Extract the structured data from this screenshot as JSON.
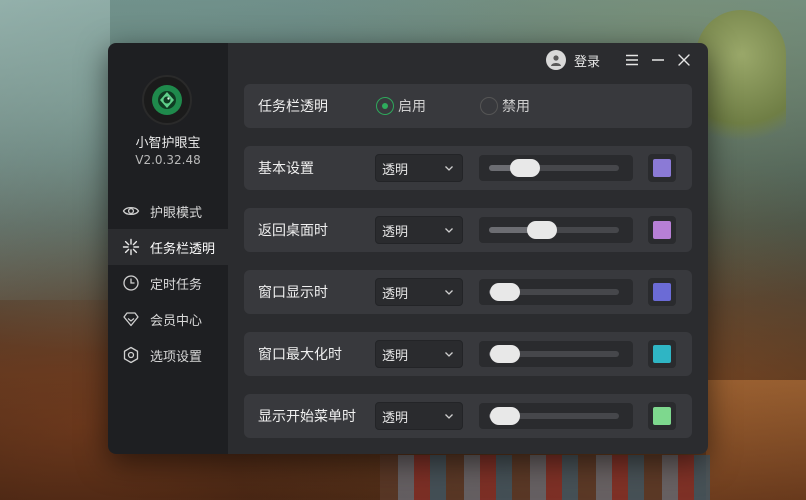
{
  "app": {
    "name": "小智护眼宝",
    "version": "V2.0.32.48"
  },
  "titlebar": {
    "login_label": "登录"
  },
  "nav": [
    {
      "label": "护眼模式",
      "icon": "eye-icon",
      "active": false
    },
    {
      "label": "任务栏透明",
      "icon": "sparkle-icon",
      "active": true
    },
    {
      "label": "定时任务",
      "icon": "clock-icon",
      "active": false
    },
    {
      "label": "会员中心",
      "icon": "diamond-icon",
      "active": false
    },
    {
      "label": "选项设置",
      "icon": "settings-icon",
      "active": false
    }
  ],
  "taskbar_toggle": {
    "label": "任务栏透明",
    "enable_label": "启用",
    "disable_label": "禁用",
    "selected": "enable"
  },
  "rows": [
    {
      "label": "基本设置",
      "mode": "透明",
      "level": 0.25,
      "color": "#8b7ad6"
    },
    {
      "label": "返回桌面时",
      "mode": "透明",
      "level": 0.42,
      "color": "#b77fd6"
    },
    {
      "label": "窗口显示时",
      "mode": "透明",
      "level": 0.05,
      "color": "#6b6bd6"
    },
    {
      "label": "窗口最大化时",
      "mode": "透明",
      "level": 0.05,
      "color": "#2fb5c4"
    },
    {
      "label": "显示开始菜单时",
      "mode": "透明",
      "level": 0.05,
      "color": "#7ed88e"
    }
  ],
  "colors": {
    "accent": "#2eaa5c",
    "sidebar_bg": "#1e1f22",
    "main_bg": "#2b2c2f",
    "card_bg": "#38393d"
  }
}
